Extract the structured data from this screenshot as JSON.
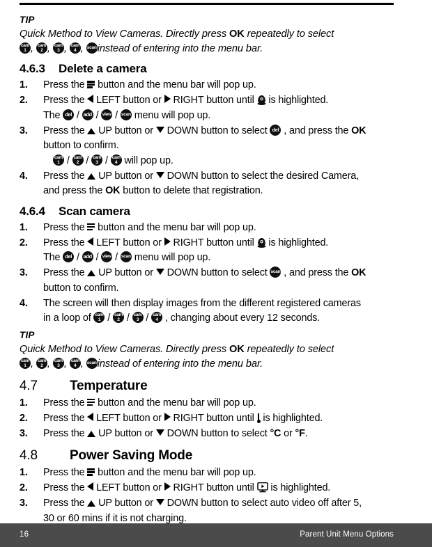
{
  "footer": {
    "page_number": "16",
    "section_title": "Parent Unit Menu Options"
  },
  "icons": {
    "cam1": "cam-1-icon",
    "cam2": "cam-2-icon",
    "cam3": "cam-3-icon",
    "cam4": "cam-4-icon",
    "scan": "scan-icon",
    "del": "del-icon",
    "add": "add-icon",
    "view": "view-icon",
    "menu": "menu-bar-icon",
    "camera": "camera-icon",
    "thermometer": "thermometer-icon",
    "monitor": "video-monitor-icon",
    "left": "left-arrow-icon",
    "right": "right-arrow-icon",
    "up": "up-arrow-icon",
    "down": "down-arrow-icon",
    "cam_label": "cam",
    "cam1_num": "1",
    "cam2_num": "2",
    "cam3_num": "3",
    "cam4_num": "4",
    "scan_label": "scan",
    "del_label": "del",
    "add_label": "add",
    "view_label": "view"
  },
  "tip_top": {
    "label": "TIP",
    "line1_a": "Quick Method to View Cameras. Directly press ",
    "line1_ok": "OK",
    "line1_b": " repeatedly to select",
    "line2_tail": "instead of entering into the menu bar.",
    "sep": ", "
  },
  "section_463": {
    "number": "4.6.3",
    "title": "Delete a camera",
    "steps": [
      {
        "marker": "1.",
        "a": "Press the ",
        "b": " button and the menu bar will pop up."
      },
      {
        "marker": "2.",
        "a": "Press the ",
        "b": " LEFT button or ",
        "c": " RIGHT button until ",
        "d": " is highlighted.",
        "line2_a": "The ",
        "line2_b": " menu will pop up.",
        "sep": " / "
      },
      {
        "marker": "3.",
        "a": "Press the ",
        "b": " UP button or ",
        "c": " DOWN button to select ",
        "d": " , and press the ",
        "ok": "OK",
        "e": "",
        "line2": "button to confirm.",
        "line3_b": " will pop up.",
        "sep": " / "
      },
      {
        "marker": "4.",
        "a": "Press the ",
        "b": " UP button or ",
        "c": " DOWN button to select the desired Camera,",
        "line2_a": "and press the ",
        "ok": "OK",
        "line2_b": " button to delete that registration."
      }
    ]
  },
  "section_464": {
    "number": "4.6.4",
    "title": "Scan camera",
    "steps": [
      {
        "marker": "1.",
        "a": "Press the ",
        "b": " button and the menu bar will pop up."
      },
      {
        "marker": "2.",
        "a": "Press the ",
        "b": " LEFT button or ",
        "c": " RIGHT button until ",
        "d": " is highlighted.",
        "line2_a": "The ",
        "line2_b": " menu will pop up.",
        "sep": " / "
      },
      {
        "marker": "3.",
        "a": "Press the ",
        "b": " UP button or ",
        "c": " DOWN button to select ",
        "d": " , and press the ",
        "ok": "OK",
        "line2": "button to confirm."
      },
      {
        "marker": "4.",
        "a": "The screen will then display images from the different registered cameras",
        "line2_a": "in a loop of ",
        "line2_b": " , changing about every 12 seconds.",
        "sep": " / "
      }
    ]
  },
  "tip_bottom": {
    "label": "TIP",
    "line1_a": "Quick Method to View Cameras. Directly press ",
    "line1_ok": "OK",
    "line1_b": " repeatedly to select",
    "line2_tail": "instead of entering into the menu bar.",
    "sep": ", "
  },
  "section_47": {
    "number": "4.7",
    "title": "Temperature",
    "steps": [
      {
        "marker": "1.",
        "a": "Press the ",
        "b": " button and the menu bar will pop up."
      },
      {
        "marker": "2.",
        "a": "Press the ",
        "b": " LEFT button or ",
        "c": " RIGHT button until ",
        "d": " is highlighted."
      },
      {
        "marker": "3.",
        "a": "Press the ",
        "b": " UP button or ",
        "c": " DOWN button to select ",
        "celsius": "°C",
        "d": " or ",
        "fahrenheit": "°F",
        "e": "."
      }
    ]
  },
  "section_48": {
    "number": "4.8",
    "title": "Power Saving Mode",
    "steps": [
      {
        "marker": "1.",
        "a": "Press the ",
        "b": " button and the menu bar will pop up."
      },
      {
        "marker": "2.",
        "a": "Press the ",
        "b": " LEFT button or ",
        "c": " RIGHT button until ",
        "d": " is highlighted."
      },
      {
        "marker": "3.",
        "a": "Press the ",
        "b": " UP button or ",
        "c": " DOWN button to select auto video off after 5,",
        "line2": "30 or 60 mins if it is not charging."
      }
    ]
  }
}
